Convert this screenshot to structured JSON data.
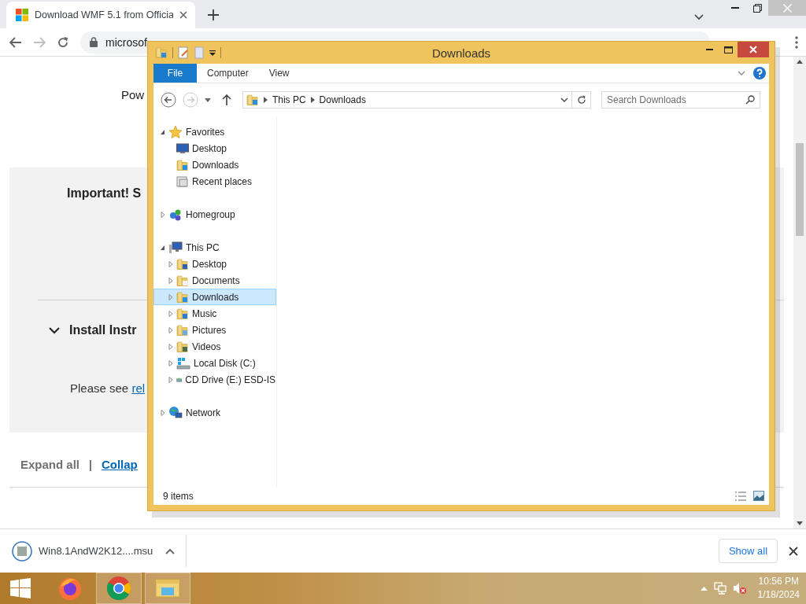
{
  "browser": {
    "tabs": [
      {
        "title": "Download WMF 5.1 from Officia",
        "selected": true
      }
    ],
    "address": "microsof",
    "page": {
      "intro": "Pow",
      "notice_heading": "Important! S",
      "section": {
        "title": "Install Instr",
        "expanded": true,
        "body": "Please see ",
        "link": "rel"
      },
      "expand_all": "Expand all",
      "separator": "|",
      "collapse_all": "Collap"
    },
    "downloads_bar": {
      "file": "Win8.1AndW2K12....msu",
      "show_all": "Show all"
    }
  },
  "explorer": {
    "title": "Downloads",
    "ribbon_tabs": [
      {
        "label": "File",
        "selected": true
      },
      {
        "label": "Computer",
        "selected": false
      },
      {
        "label": "View",
        "selected": false
      }
    ],
    "path": [
      "This PC",
      "Downloads"
    ],
    "search": {
      "placeholder": "Search Downloads"
    },
    "nav_tree": [
      {
        "label": "Favorites",
        "kind": "star",
        "expanded": true,
        "selected": false,
        "children": [
          {
            "label": "Desktop",
            "kind": "desktop",
            "selected": false
          },
          {
            "label": "Downloads",
            "kind": "downloads",
            "selected": false
          },
          {
            "label": "Recent places",
            "kind": "recent",
            "selected": false
          }
        ]
      },
      {
        "label": "Homegroup",
        "kind": "homegroup",
        "expanded": false,
        "selected": false
      },
      {
        "label": "This PC",
        "kind": "computer",
        "expanded": true,
        "selected": false,
        "children": [
          {
            "label": "Desktop",
            "kind": "folder-desktop",
            "expanded": false,
            "selected": false
          },
          {
            "label": "Documents",
            "kind": "documents",
            "expanded": false,
            "selected": false
          },
          {
            "label": "Downloads",
            "kind": "downloads",
            "expanded": false,
            "selected": true
          },
          {
            "label": "Music",
            "kind": "music",
            "expanded": false,
            "selected": false
          },
          {
            "label": "Pictures",
            "kind": "pictures",
            "expanded": false,
            "selected": false
          },
          {
            "label": "Videos",
            "kind": "videos",
            "expanded": false,
            "selected": false
          },
          {
            "label": "Local Disk (C:)",
            "kind": "disk",
            "expanded": false,
            "selected": false
          },
          {
            "label": "CD Drive (E:) ESD-IS",
            "kind": "cd",
            "expanded": false,
            "selected": false
          }
        ]
      },
      {
        "label": "Network",
        "kind": "network",
        "expanded": false,
        "selected": false
      }
    ],
    "status": "9 items"
  },
  "taskbar": {
    "apps": [
      {
        "kind": "firefox",
        "active": false
      },
      {
        "kind": "chrome",
        "active": true
      },
      {
        "kind": "explorer",
        "active": true
      }
    ],
    "time": "10:56 PM",
    "date": "1/18/2024"
  }
}
